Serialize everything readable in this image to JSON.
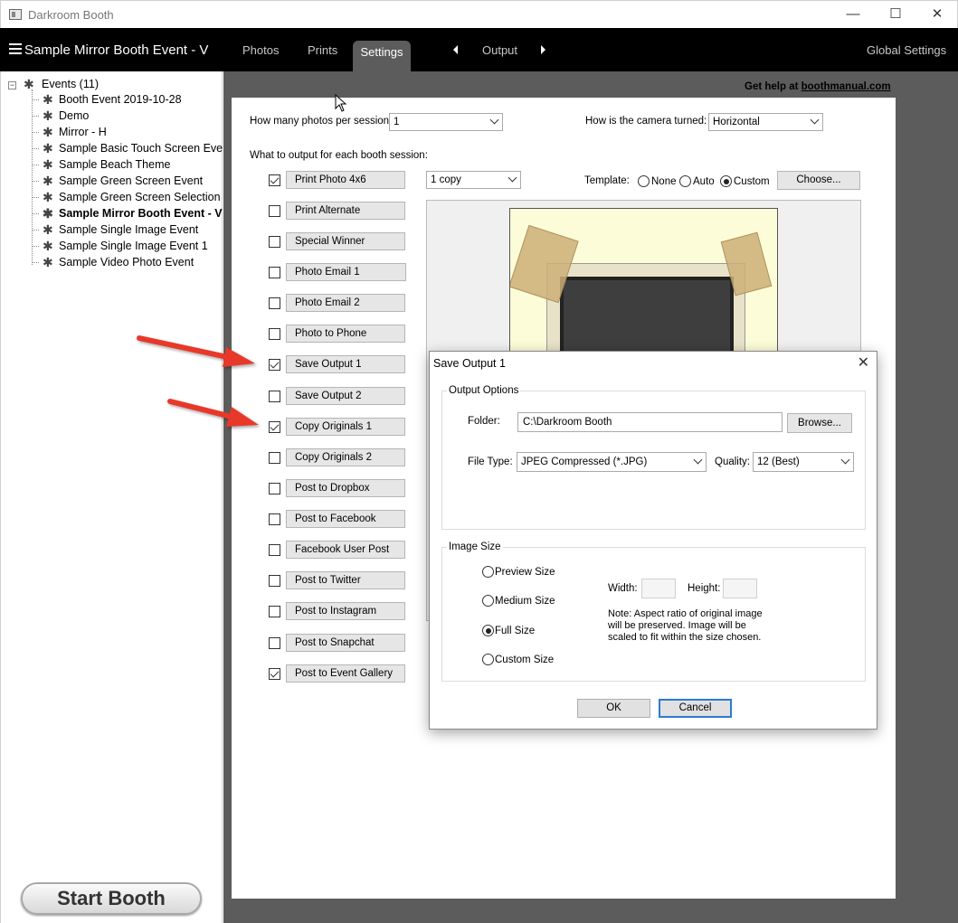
{
  "window": {
    "title": "Darkroom Booth",
    "minimize": "—",
    "maximize": "☐",
    "close": "✕"
  },
  "menubar": {
    "event_title": "Sample Mirror Booth Event - V",
    "tabs": [
      "Photos",
      "Prints",
      "Settings"
    ],
    "active_tab": "Settings",
    "output_label": "Output",
    "global_settings": "Global Settings"
  },
  "sidebar": {
    "root_label": "Events (11)",
    "toggle": "−",
    "items": [
      "Booth Event 2019-10-28",
      "Demo",
      "Mirror - H",
      "Sample Basic Touch Screen Event",
      "Sample Beach Theme",
      "Sample Green Screen Event",
      "Sample Green Screen Selection",
      "Sample Mirror Booth Event - V",
      "Sample Single Image Event",
      "Sample Single Image Event  1",
      "Sample Video Photo Event"
    ],
    "selected_index": 7,
    "start_button": "Start Booth"
  },
  "help": {
    "prefix": "Get help at ",
    "link": "boothmanual.com"
  },
  "settings": {
    "photos_per_session_label": "How many photos per session:",
    "photos_per_session_value": "1",
    "camera_turned_label": "How is the camera turned:",
    "camera_turned_value": "Horizontal",
    "output_heading": "What to output for each booth session:",
    "copies_value": "1 copy",
    "template_label": "Template:",
    "template_options": [
      "None",
      "Auto",
      "Custom"
    ],
    "template_selected": "Custom",
    "choose_button": "Choose...",
    "outputs": [
      {
        "label": "Print Photo  4x6",
        "checked": true
      },
      {
        "label": "Print Alternate",
        "checked": false
      },
      {
        "label": "Special Winner",
        "checked": false
      },
      {
        "label": "Photo Email 1",
        "checked": false
      },
      {
        "label": "Photo Email 2",
        "checked": false
      },
      {
        "label": "Photo to Phone",
        "checked": false
      },
      {
        "label": "Save Output 1",
        "checked": true
      },
      {
        "label": "Save Output 2",
        "checked": false
      },
      {
        "label": "Copy Originals 1",
        "checked": true
      },
      {
        "label": "Copy Originals 2",
        "checked": false
      },
      {
        "label": "Post to Dropbox",
        "checked": false
      },
      {
        "label": "Post to Facebook",
        "checked": false
      },
      {
        "label": "Facebook User Post",
        "checked": false
      },
      {
        "label": "Post to Twitter",
        "checked": false
      },
      {
        "label": "Post to Instagram",
        "checked": false
      },
      {
        "label": "Post to Snapchat",
        "checked": false
      },
      {
        "label": "Post to Event Gallery",
        "checked": true
      }
    ]
  },
  "dialog": {
    "title": "Save Output 1",
    "close": "✕",
    "output_options_title": "Output Options",
    "folder_label": "Folder:",
    "folder_value": "C:\\Darkroom Booth",
    "browse_button": "Browse...",
    "file_type_label": "File Type:",
    "file_type_value": "JPEG Compressed (*.JPG)",
    "quality_label": "Quality:",
    "quality_value": "12 (Best)",
    "image_size_title": "Image Size",
    "size_options": [
      "Preview Size",
      "Medium Size",
      "Full Size",
      "Custom Size"
    ],
    "size_selected": "Full Size",
    "width_label": "Width:",
    "height_label": "Height:",
    "note": "Note: Aspect ratio of original image will be preserved. Image will be scaled to fit within the size chosen.",
    "ok_button": "OK",
    "cancel_button": "Cancel"
  },
  "colors": {
    "menubar_bg": "#000000",
    "active_tab_bg": "#5c5c5c",
    "main_bg": "#5c5c5c",
    "arrow_red": "#e8392b",
    "default_button_border": "#2c7ad6"
  }
}
